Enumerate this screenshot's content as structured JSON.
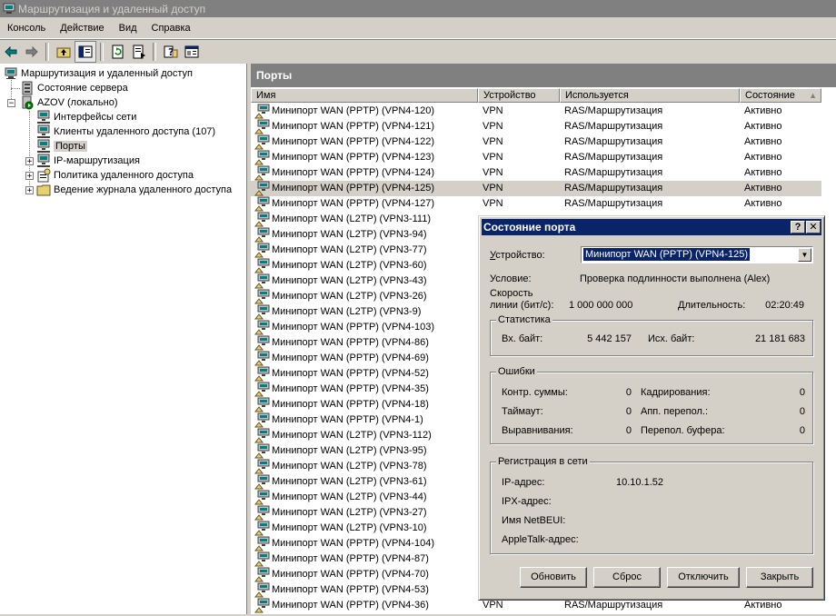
{
  "window": {
    "title": "Маршрутизация и удаленный доступ"
  },
  "menu": [
    "Консоль",
    "Действие",
    "Вид",
    "Справка"
  ],
  "toolbar_icons": [
    "back-arrow-icon",
    "forward-arrow-icon",
    "up-folder-icon",
    "show-hide-tree-icon",
    "refresh-icon",
    "export-list-icon",
    "help-icon",
    "properties-icon"
  ],
  "tree": {
    "root": "Маршрутизация и удаленный доступ",
    "server_status": "Состояние сервера",
    "server": "AZOV (локально)",
    "children": [
      {
        "label": "Интерфейсы сети",
        "expandable": false
      },
      {
        "label": "Клиенты удаленного доступа (107)",
        "expandable": false
      },
      {
        "label": "Порты",
        "expandable": false,
        "selected": true
      },
      {
        "label": "IP-маршрутизация",
        "expandable": true
      },
      {
        "label": "Политика удаленного доступа",
        "expandable": true
      },
      {
        "label": "Ведение журнала удаленного доступа",
        "expandable": true
      }
    ]
  },
  "panel": {
    "title": "Порты",
    "columns": [
      "Имя",
      "Устройство",
      "Используется",
      "Состояние"
    ],
    "sort_indicator": "▲",
    "rows": [
      {
        "name": "Минипорт WAN (PPTP) (VPN4-120)",
        "device": "VPN",
        "used": "RAS/Маршрутизация",
        "status": "Активно"
      },
      {
        "name": "Минипорт WAN (PPTP) (VPN4-121)",
        "device": "VPN",
        "used": "RAS/Маршрутизация",
        "status": "Активно"
      },
      {
        "name": "Минипорт WAN (PPTP) (VPN4-122)",
        "device": "VPN",
        "used": "RAS/Маршрутизация",
        "status": "Активно"
      },
      {
        "name": "Минипорт WAN (PPTP) (VPN4-123)",
        "device": "VPN",
        "used": "RAS/Маршрутизация",
        "status": "Активно"
      },
      {
        "name": "Минипорт WAN (PPTP) (VPN4-124)",
        "device": "VPN",
        "used": "RAS/Маршрутизация",
        "status": "Активно"
      },
      {
        "name": "Минипорт WAN (PPTP) (VPN4-125)",
        "device": "VPN",
        "used": "RAS/Маршрутизация",
        "status": "Активно",
        "selected": true
      },
      {
        "name": "Минипорт WAN (PPTP) (VPN4-127)",
        "device": "VPN",
        "used": "RAS/Маршрутизация",
        "status": "Активно"
      },
      {
        "name": "Минипорт WAN (L2TP) (VPN3-111)"
      },
      {
        "name": "Минипорт WAN (L2TP) (VPN3-94)"
      },
      {
        "name": "Минипорт WAN (L2TP) (VPN3-77)"
      },
      {
        "name": "Минипорт WAN (L2TP) (VPN3-60)"
      },
      {
        "name": "Минипорт WAN (L2TP) (VPN3-43)"
      },
      {
        "name": "Минипорт WAN (L2TP) (VPN3-26)"
      },
      {
        "name": "Минипорт WAN (L2TP) (VPN3-9)"
      },
      {
        "name": "Минипорт WAN (PPTP) (VPN4-103)"
      },
      {
        "name": "Минипорт WAN (PPTP) (VPN4-86)"
      },
      {
        "name": "Минипорт WAN (PPTP) (VPN4-69)"
      },
      {
        "name": "Минипорт WAN (PPTP) (VPN4-52)"
      },
      {
        "name": "Минипорт WAN (PPTP) (VPN4-35)"
      },
      {
        "name": "Минипорт WAN (PPTP) (VPN4-18)"
      },
      {
        "name": "Минипорт WAN (PPTP) (VPN4-1)"
      },
      {
        "name": "Минипорт WAN (L2TP) (VPN3-112)"
      },
      {
        "name": "Минипорт WAN (L2TP) (VPN3-95)"
      },
      {
        "name": "Минипорт WAN (L2TP) (VPN3-78)"
      },
      {
        "name": "Минипорт WAN (L2TP) (VPN3-61)"
      },
      {
        "name": "Минипорт WAN (L2TP) (VPN3-44)"
      },
      {
        "name": "Минипорт WAN (L2TP) (VPN3-27)"
      },
      {
        "name": "Минипорт WAN (L2TP) (VPN3-10)"
      },
      {
        "name": "Минипорт WAN (PPTP) (VPN4-104)"
      },
      {
        "name": "Минипорт WAN (PPTP) (VPN4-87)"
      },
      {
        "name": "Минипорт WAN (PPTP) (VPN4-70)"
      },
      {
        "name": "Минипорт WAN (PPTP) (VPN4-53)"
      },
      {
        "name": "Минипорт WAN (PPTP) (VPN4-36)",
        "device": "VPN",
        "used": "RAS/Маршрутизация",
        "status": "Активно"
      }
    ]
  },
  "dialog": {
    "title": "Состояние порта",
    "help_btn": "?",
    "close_btn": "✕",
    "device_label": "Устройство:",
    "device_value": "Минипорт WAN (PPTP) (VPN4-125)",
    "condition_label": "Условие:",
    "condition_value": "Проверка подлинности выполнена (Alex)",
    "speed_label_1": "Скорость",
    "speed_label_2": "линии (бит/с):",
    "speed_value": "1 000 000 000",
    "duration_label": "Длительность:",
    "duration_value": "02:20:49",
    "stats": {
      "title": "Статистика",
      "in_label": "Вх. байт:",
      "in_value": "5 442 157",
      "out_label": "Исх. байт:",
      "out_value": "21 181 683"
    },
    "errors": {
      "title": "Ошибки",
      "crc_label": "Контр. суммы:",
      "crc_value": "0",
      "framing_label": "Кадрирования:",
      "framing_value": "0",
      "timeout_label": "Таймаут:",
      "timeout_value": "0",
      "hw_overrun_label": "Апп. перепол.:",
      "hw_overrun_value": "0",
      "alignment_label": "Выравнивания:",
      "alignment_value": "0",
      "buffer_overrun_label": "Перепол. буфера:",
      "buffer_overrun_value": "0"
    },
    "network": {
      "title": "Регистрация в сети",
      "ip_label": "IP-адрес:",
      "ip_value": "10.10.1.52",
      "ipx_label": "IPX-адрес:",
      "netbeui_label": "Имя NetBEUI:",
      "appletalk_label": "AppleTalk-адрес:"
    },
    "buttons": {
      "refresh": "Обновить",
      "reset": "Сброс",
      "disconnect": "Отключить",
      "close": "Закрыть"
    }
  }
}
